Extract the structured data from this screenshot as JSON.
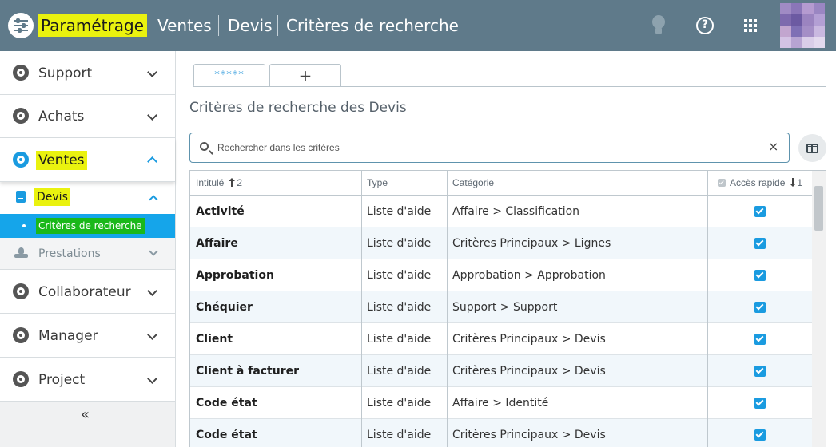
{
  "header": {
    "breadcrumbs": [
      "Paramétrage",
      "Ventes",
      "Devis",
      "Critères de recherche"
    ],
    "highlight_color": "#eaf20f",
    "bar_color": "#5f7a8a",
    "icons": [
      "settings-logo-icon",
      "lightbulb-icon",
      "help-icon",
      "apps-grid-icon",
      "avatar"
    ]
  },
  "sidebar": {
    "items": [
      {
        "label": "Support",
        "icon": "headset-icon"
      },
      {
        "label": "Achats",
        "icon": "bag-icon"
      },
      {
        "label": "Ventes",
        "icon": "handshake-icon",
        "expanded": true
      },
      {
        "label": "Collaborateur",
        "icon": "user-icon"
      },
      {
        "label": "Manager",
        "icon": "network-icon"
      },
      {
        "label": "Project",
        "icon": "project-icon"
      }
    ],
    "sub_devis": "Devis",
    "sub_criteres": "Critères de recherche",
    "sub_prestations": "Prestations",
    "collapse": "«",
    "active_color": "#15a5ea"
  },
  "main": {
    "tabs": [
      "*****",
      "+"
    ],
    "title": "Critères de recherche des Devis",
    "search": {
      "placeholder": "Rechercher dans les critères",
      "value": "",
      "clear": "×"
    },
    "table": {
      "headers": {
        "name": "Intitulé",
        "name_sort": "2",
        "type": "Type",
        "category": "Catégorie",
        "quick": "Accès rapide",
        "quick_sort": "1"
      },
      "rows": [
        {
          "name": "Activité",
          "type": "Liste d'aide",
          "category": "Affaire > Classification",
          "quick": true
        },
        {
          "name": "Affaire",
          "type": "Liste d'aide",
          "category": "Critères Principaux > Lignes",
          "quick": true
        },
        {
          "name": "Approbation",
          "type": "Liste d'aide",
          "category": "Approbation > Approbation",
          "quick": true
        },
        {
          "name": "Chéquier",
          "type": "Liste d'aide",
          "category": "Support > Support",
          "quick": true
        },
        {
          "name": "Client",
          "type": "Liste d'aide",
          "category": "Critères Principaux > Devis",
          "quick": true
        },
        {
          "name": "Client à facturer",
          "type": "Liste d'aide",
          "category": "Critères Principaux > Devis",
          "quick": true
        },
        {
          "name": "Code état",
          "type": "Liste d'aide",
          "category": "Affaire > Identité",
          "quick": true
        },
        {
          "name": "Code état",
          "type": "Liste d'aide",
          "category": "Critères Principaux > Devis",
          "quick": true
        }
      ]
    }
  }
}
